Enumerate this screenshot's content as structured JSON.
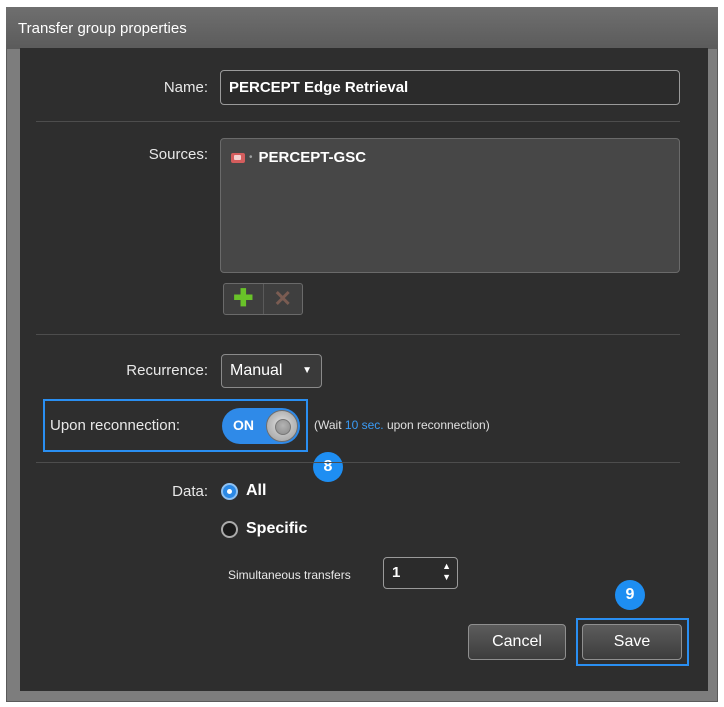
{
  "dialog": {
    "title": "Transfer group properties"
  },
  "name": {
    "label": "Name:",
    "value": "PERCEPT Edge Retrieval"
  },
  "sources": {
    "label": "Sources:",
    "items": [
      {
        "name": "PERCEPT-GSC",
        "icon": "camera-icon"
      }
    ],
    "add_icon": "plus-icon",
    "remove_icon": "x-icon"
  },
  "recurrence": {
    "label": "Recurrence:",
    "value": "Manual"
  },
  "reconnection": {
    "label": "Upon reconnection:",
    "toggle_label": "ON",
    "toggle_state": "on",
    "wait_prefix": "(Wait",
    "wait_time": "10 sec.",
    "wait_suffix": "upon reconnection)"
  },
  "data": {
    "label": "Data:",
    "options": [
      {
        "label": "All",
        "checked": true
      },
      {
        "label": "Specific",
        "checked": false
      }
    ]
  },
  "simultaneous": {
    "label": "Simultaneous transfers",
    "value": "1"
  },
  "buttons": {
    "cancel": "Cancel",
    "save": "Save"
  },
  "callouts": {
    "toggle_step": "8",
    "save_step": "9"
  },
  "colors": {
    "accent": "#2a8ff2",
    "panel_bg": "#2e2e2e",
    "add_green": "#69c229"
  }
}
